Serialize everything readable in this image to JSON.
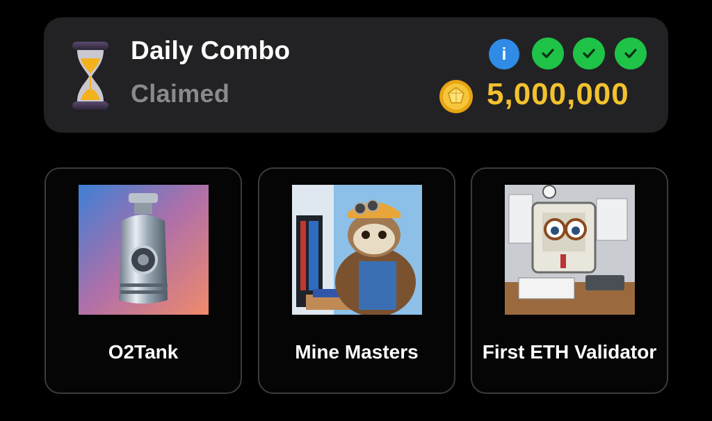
{
  "daily_combo": {
    "title": "Daily Combo",
    "status": "Claimed",
    "info_label": "i",
    "checks": [
      "check-icon",
      "check-icon",
      "check-icon"
    ],
    "reward": "5,000,000",
    "colors": {
      "banner": "#222224",
      "reward": "#f2c12e",
      "check": "#1ec347",
      "info": "#2f8be6"
    }
  },
  "cards": [
    {
      "name": "O2Tank",
      "image": "oxygen-tank-image"
    },
    {
      "name": "Mine Masters",
      "image": "sloth-miner-image"
    },
    {
      "name": "First ETH Validator",
      "image": "computer-validator-image"
    }
  ]
}
